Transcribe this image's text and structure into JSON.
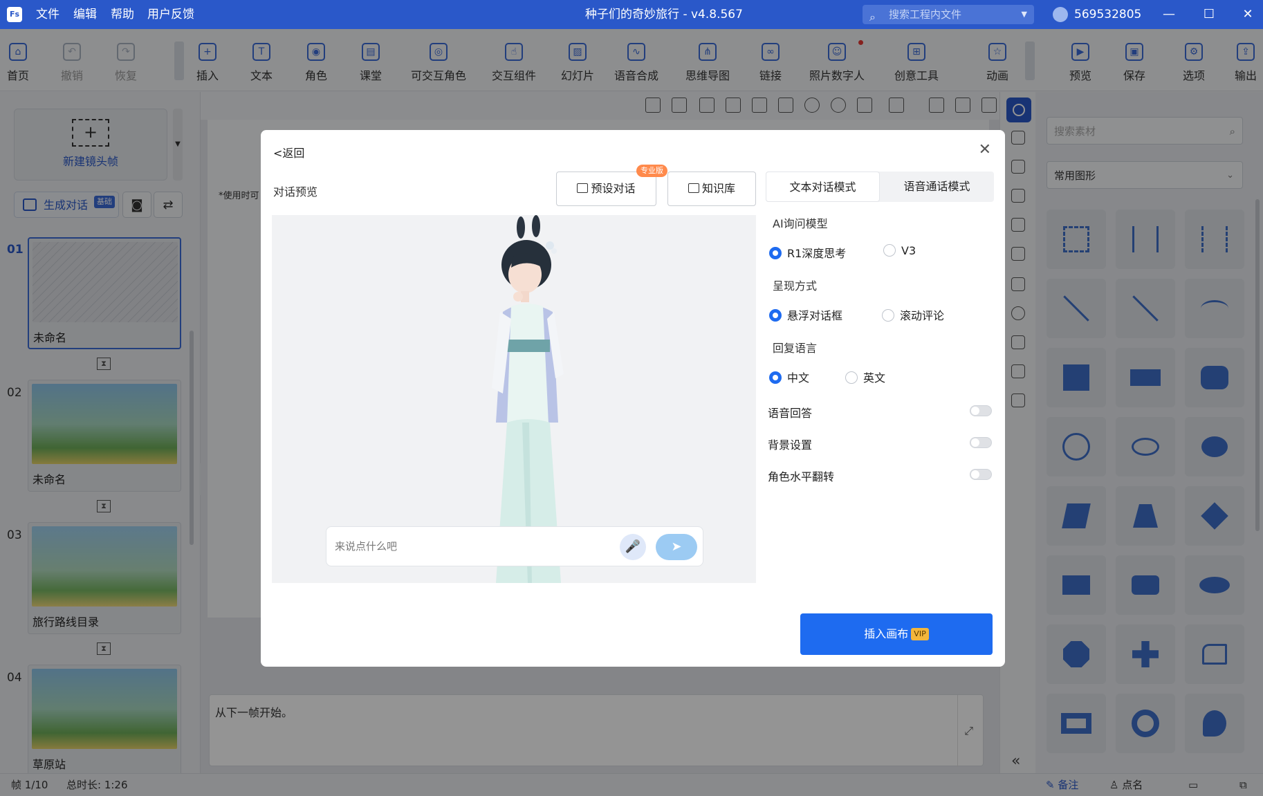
{
  "app": {
    "logo": "Fs",
    "title": "种子们的奇妙旅行 - v4.8.567",
    "menu": [
      "文件",
      "编辑",
      "帮助",
      "用户反馈"
    ],
    "search_placeholder": "搜索工程内文件",
    "user_id": "569532805"
  },
  "toolbar": {
    "items": [
      "首页",
      "撤销",
      "恢复",
      "插入",
      "文本",
      "角色",
      "课堂",
      "可交互角色",
      "交互组件",
      "幻灯片",
      "语音合成",
      "思维导图",
      "链接",
      "照片数字人",
      "创意工具",
      "动画",
      "预览",
      "保存",
      "选项",
      "输出"
    ]
  },
  "left_panel": {
    "new_frame": "新建镜头帧",
    "gen_dialog": "生成对话",
    "gen_dialog_badge": "基础",
    "frames": [
      {
        "num": "01",
        "label": "未命名"
      },
      {
        "num": "02",
        "label": "未命名"
      },
      {
        "num": "03",
        "label": "旅行路线目录"
      },
      {
        "num": "04",
        "label": "草原站"
      }
    ]
  },
  "canvas": {
    "hint": "*使用时可",
    "notes": "从下一帧开始。"
  },
  "shape_panel": {
    "search_placeholder": "搜索素材",
    "category": "常用图形"
  },
  "status": {
    "frame": "帧 1/10",
    "duration": "总时长: 1:26",
    "notes": "备注",
    "roll_call": "点名"
  },
  "modal": {
    "back": "<返回",
    "preview_title": "对话预览",
    "preset_dialog": "预设对话",
    "pro_badge": "专业版",
    "knowledge_base": "知识库",
    "tabs": {
      "text_mode": "文本对话模式",
      "voice_mode": "语音通话模式",
      "selected": "text_mode"
    },
    "ai_model": {
      "label": "AI询问模型",
      "options": [
        "R1深度思考",
        "V3"
      ],
      "selected": "R1深度思考"
    },
    "presentation": {
      "label": "呈现方式",
      "options": [
        "悬浮对话框",
        "滚动评论"
      ],
      "selected": "悬浮对话框"
    },
    "reply_language": {
      "label": "回复语言",
      "options": [
        "中文",
        "英文"
      ],
      "selected": "中文"
    },
    "toggles": [
      {
        "label": "语音回答",
        "on": false
      },
      {
        "label": "背景设置",
        "on": false
      },
      {
        "label": "角色水平翻转",
        "on": false
      }
    ],
    "chat_placeholder": "来说点什么吧",
    "insert_button": "插入画布",
    "insert_badge": "VIP"
  },
  "colors": {
    "titlebar": "#2a58c9",
    "primary": "#1e6bf0",
    "pro_badge": "#ff8a4c",
    "vip_badge": "#f3b63b"
  }
}
